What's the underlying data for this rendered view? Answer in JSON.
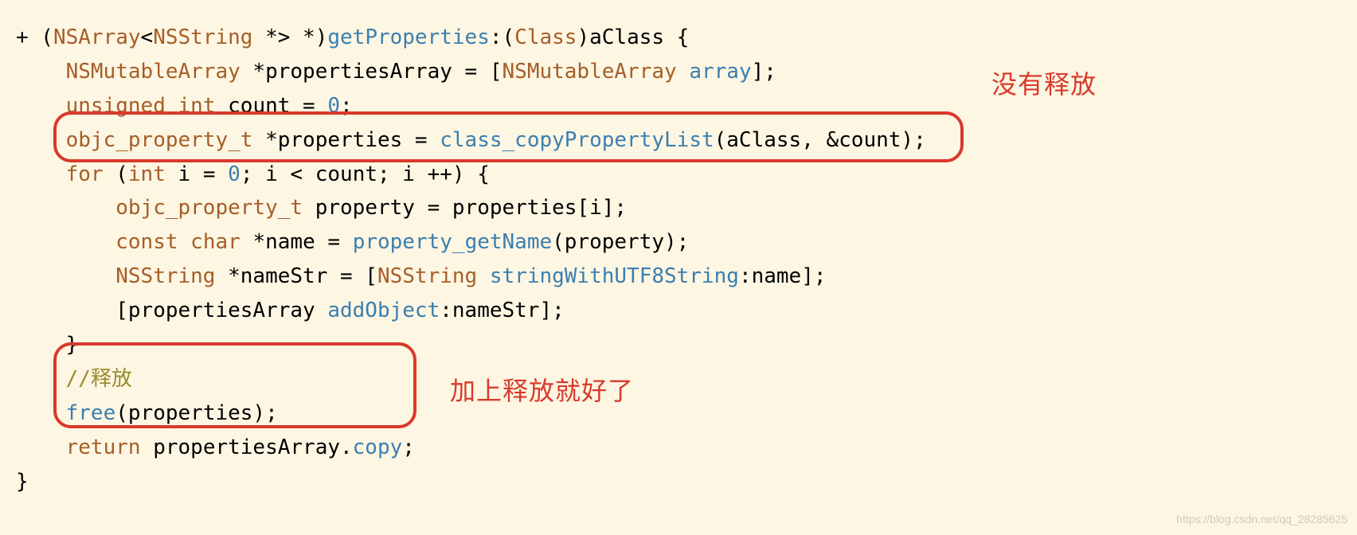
{
  "annotations": {
    "no_release": "没有释放",
    "add_release": "加上释放就好了"
  },
  "code": {
    "line1": {
      "plus": "+ (",
      "nsarray": "NSArray",
      "lt": "<",
      "nsstring": "NSString",
      "star_gt": " *> *)",
      "method": "getProperties",
      "colon_open": ":(",
      "class": "Class",
      "param": ")aClass {"
    },
    "line2": {
      "indent": "    ",
      "nsmutable": "NSMutableArray",
      "mid": " *propertiesArray = [",
      "nsmutable2": "NSMutableArray",
      "sp": " ",
      "array_msg": "array",
      "end": "];"
    },
    "line3": {
      "indent": "    ",
      "unsigned": "unsigned",
      "sp1": " ",
      "int": "int",
      "mid": " count = ",
      "zero": "0",
      "semi": ";"
    },
    "line4": {
      "indent": "    ",
      "objc_prop_t": "objc_property_t",
      "mid": " *properties = ",
      "copyfn": "class_copyPropertyList",
      "args": "(aClass, &count);"
    },
    "line5": {
      "indent": "    ",
      "for": "for",
      "open": " (",
      "int": "int",
      "mid1": " i = ",
      "zero": "0",
      "mid2": "; i < count; i ++) {"
    },
    "line6": {
      "indent": "        ",
      "objc_prop_t": "objc_property_t",
      "rest": " property = properties[i];"
    },
    "line7": {
      "indent": "        ",
      "const": "const",
      "sp": " ",
      "char": "char",
      "mid": " *name = ",
      "getname": "property_getName",
      "args": "(property);"
    },
    "line8": {
      "indent": "        ",
      "nsstring": "NSString",
      "mid": " *nameStr = [",
      "nsstring2": "NSString",
      "sp": " ",
      "stringwith": "stringWithUTF8String",
      "args": ":name];"
    },
    "line9": {
      "indent": "        ",
      "open": "[propertiesArray ",
      "addobj": "addObject",
      "args": ":nameStr];"
    },
    "line10": {
      "indent": "    ",
      "brace": "}"
    },
    "line11": {
      "indent": "    ",
      "comment": "//释放"
    },
    "line12": {
      "indent": "    ",
      "free": "free",
      "args": "(properties);"
    },
    "line13": {
      "indent": "    ",
      "return": "return",
      "mid": " propertiesArray.",
      "copy": "copy",
      "semi": ";"
    },
    "line14": {
      "brace": "}"
    }
  },
  "watermark": "https://blog.csdn.net/qq_28285625"
}
